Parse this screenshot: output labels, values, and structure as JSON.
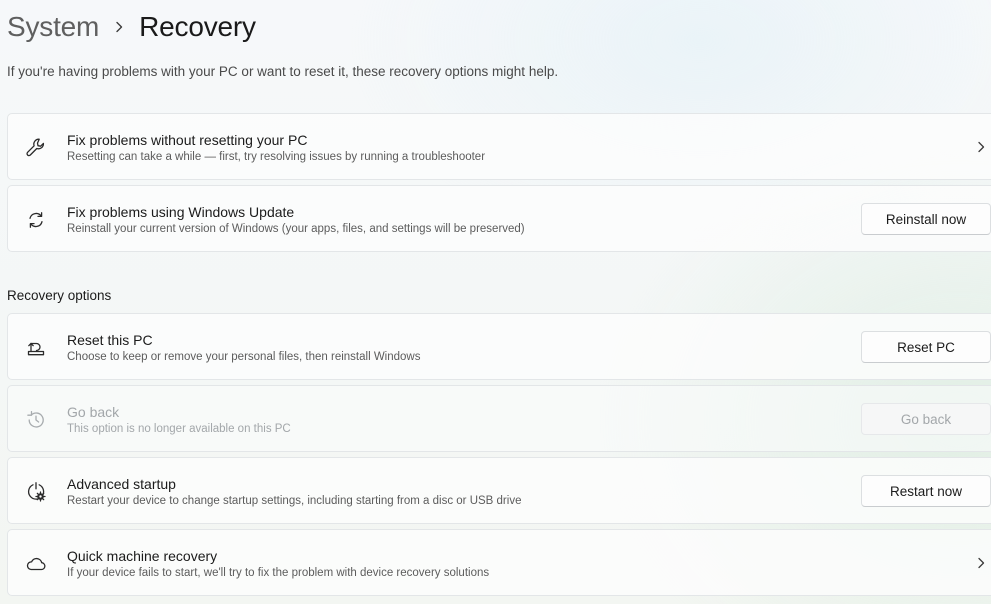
{
  "breadcrumb": {
    "parent": "System",
    "current": "Recovery"
  },
  "intro": "If you're having problems with your PC or want to reset it, these recovery options might help.",
  "troubleshoot_cards": [
    {
      "icon": "wrench-icon",
      "title": "Fix problems without resetting your PC",
      "subtitle": "Resetting can take a while — first, try resolving issues by running a troubleshooter"
    },
    {
      "icon": "sync-icon",
      "title": "Fix problems using Windows Update",
      "subtitle": "Reinstall your current version of Windows (your apps, files, and settings will be preserved)",
      "button": "Reinstall now"
    }
  ],
  "recovery_section_title": "Recovery options",
  "recovery_options": [
    {
      "icon": "reset-pc-icon",
      "title": "Reset this PC",
      "subtitle": "Choose to keep or remove your personal files, then reinstall Windows",
      "button": "Reset PC"
    },
    {
      "icon": "history-icon",
      "title": "Go back",
      "subtitle": "This option is no longer available on this PC",
      "button": "Go back",
      "disabled": true
    },
    {
      "icon": "advanced-startup-icon",
      "title": "Advanced startup",
      "subtitle": "Restart your device to change startup settings, including starting from a disc or USB drive",
      "button": "Restart now"
    },
    {
      "icon": "cloud-icon",
      "title": "Quick machine recovery",
      "subtitle": "If your device fails to start, we'll try to fix the problem with device recovery solutions"
    }
  ],
  "colors": {
    "text_primary": "#1b1b1b",
    "text_secondary": "#5c5c5c",
    "text_disabled": "#a3a7aa",
    "card_border": "#e3e6e8"
  }
}
